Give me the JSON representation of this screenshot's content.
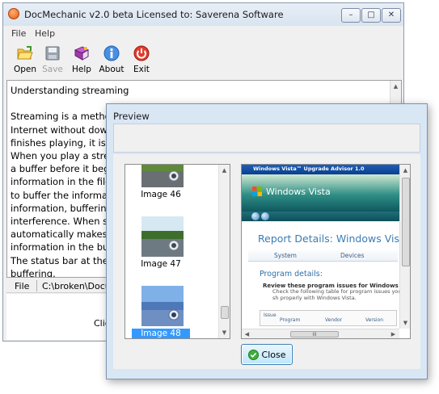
{
  "main_window": {
    "title": "DocMechanic v2.0 beta   Licensed to: Saverena Software",
    "caption_min": "–",
    "caption_max": "□",
    "caption_close": "✕"
  },
  "menu": {
    "items": [
      "File",
      "Help"
    ]
  },
  "toolbar": {
    "buttons": [
      {
        "label": "Open",
        "icon": "open-folder-icon",
        "enabled": true
      },
      {
        "label": "Save",
        "icon": "save-icon",
        "enabled": false
      },
      {
        "label": "Help",
        "icon": "help-book-icon",
        "enabled": true
      },
      {
        "label": "About",
        "icon": "info-icon",
        "enabled": true
      },
      {
        "label": "Exit",
        "icon": "exit-power-icon",
        "enabled": true
      }
    ]
  },
  "document": {
    "heading": "Understanding streaming",
    "lines": [
      "Streaming is a method",
      "Internet without dow",
      "finishes playing, it is n",
      "When you play a strea",
      "a buffer before it begi",
      "information in the file",
      "to buffer the informat",
      "information, buffering",
      "interference. When st",
      "automatically makes a",
      "information in the buf",
      "The status bar at the b",
      "buffering."
    ]
  },
  "statusbar": {
    "label": "File",
    "path": "C:\\broken\\Docu"
  },
  "bottom_area": {
    "text": "Clic"
  },
  "preview_dialog": {
    "title": "Preview",
    "thumbnails": [
      {
        "caption": "Image 46",
        "selected": false
      },
      {
        "caption": "Image 47",
        "selected": false
      },
      {
        "caption": "Image 48",
        "selected": true
      }
    ],
    "screenshot": {
      "window_title": "Windows Vista™ Upgrade Advisor 1.0",
      "logo_text": "Windows Vista",
      "report_title": "Report Details: Windows Vista",
      "tabs": [
        "System",
        "Devices"
      ],
      "section_title": "Program details:",
      "bullet_text": "Review these program issues for Windows Vista",
      "body_text": "Check the following table for program issues you sh properly with Windows Vista.",
      "grid_header_1": "Issue",
      "grid_columns": [
        "Program",
        "Vendor",
        "Version"
      ],
      "hscroll_grip": "III"
    },
    "close_label": "Close"
  },
  "colors": {
    "selection": "#3399ff",
    "accent": "#3c7fb1",
    "dialog_bg": "#d9e6f4"
  }
}
